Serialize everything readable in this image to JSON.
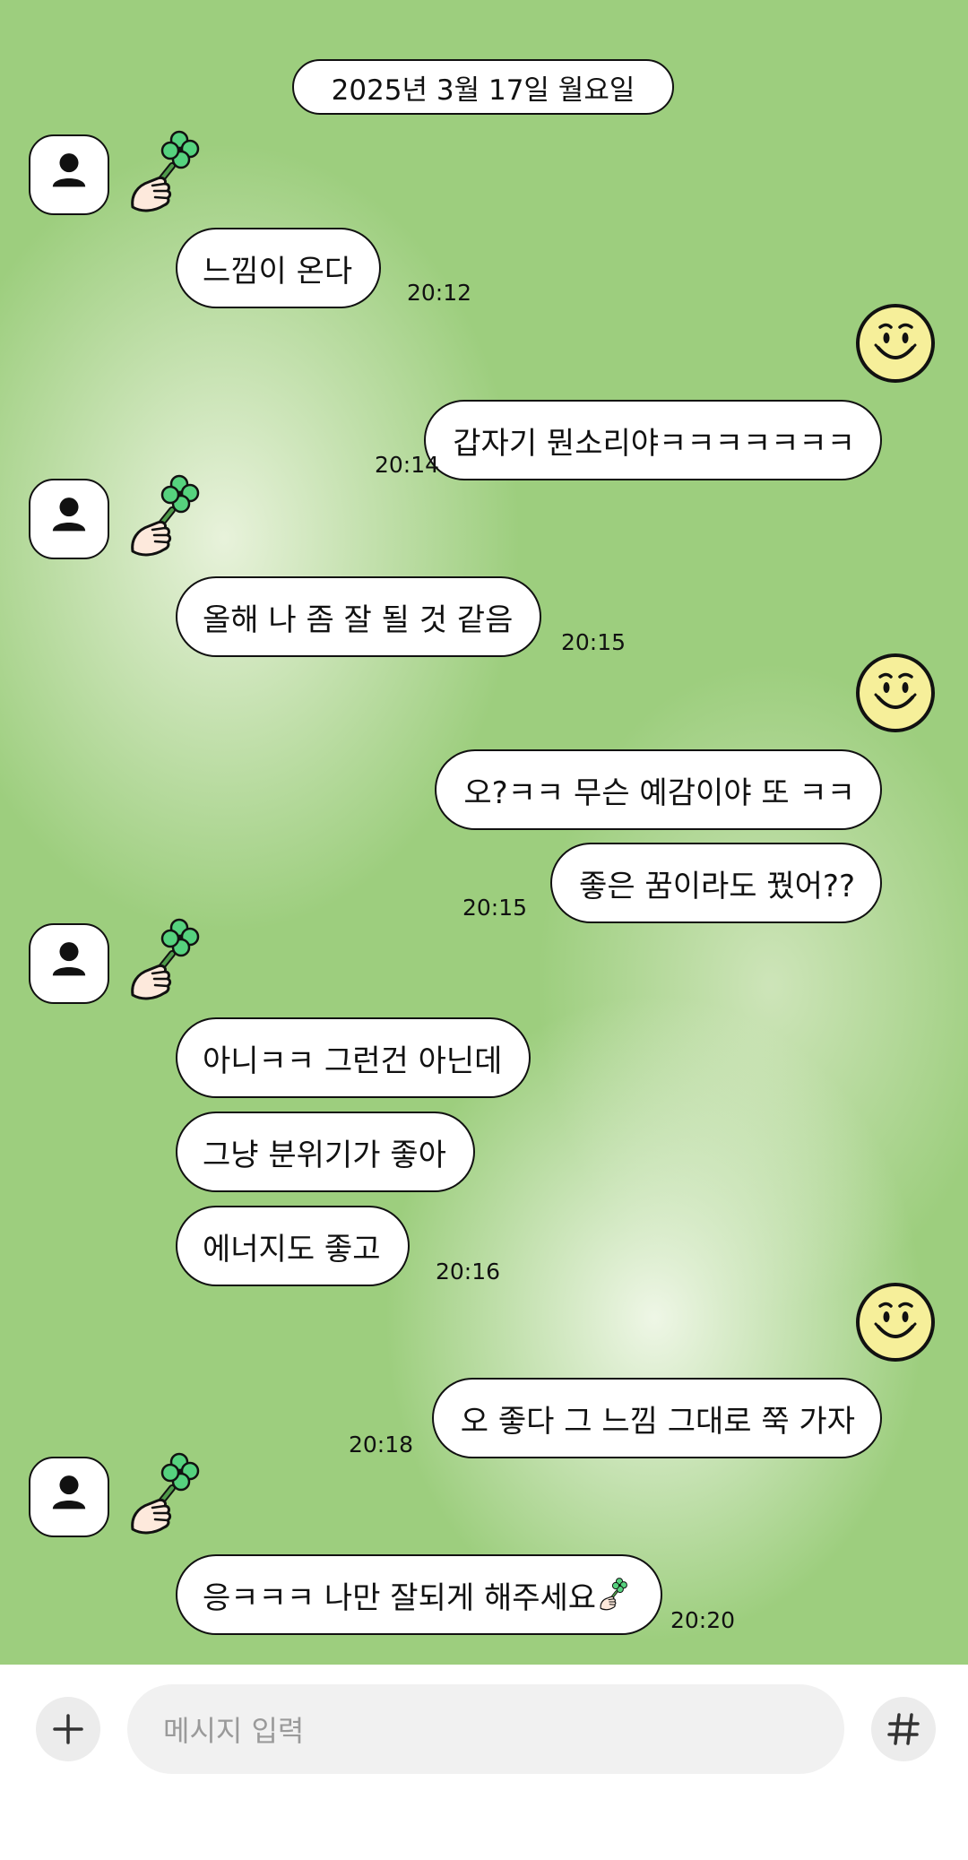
{
  "date_divider": "2025년 3월 17일 월요일",
  "messages": [
    {
      "text": "느낌이 온다",
      "time": "20:12"
    },
    {
      "text": "갑자기 뭔소리야ㅋㅋㅋㅋㅋㅋㅋ",
      "time": "20:14"
    },
    {
      "text": "올해 나 좀 잘 될 것 같음",
      "time": "20:15"
    },
    {
      "text": "오?ㅋㅋ 무슨 예감이야 또 ㅋㅋ",
      "time": ""
    },
    {
      "text": "좋은 꿈이라도 꿨어??",
      "time": "20:15"
    },
    {
      "text": "아니ㅋㅋ 그런건 아닌데",
      "time": ""
    },
    {
      "text": "그냥 분위기가 좋아",
      "time": ""
    },
    {
      "text": "에너지도 좋고",
      "time": "20:16"
    },
    {
      "text": "오 좋다 그 느낌 그대로 쭉 가자",
      "time": "20:18"
    },
    {
      "text": "응ㅋㅋㅋ 나만 잘되게 해주세요",
      "time": "20:20"
    }
  ],
  "input": {
    "placeholder": "메시지 입력"
  },
  "icons": {
    "attach": "plus-icon",
    "hashtag": "hash-icon",
    "avatar": "person-icon",
    "sticker": "clover-hand-icon",
    "emoji": "smiley-icon"
  },
  "colors": {
    "background": "#9dce7e",
    "bubble": "#ffffff",
    "outline": "#111111",
    "smiley": "#f6ef9a",
    "clover": "#55d07c"
  }
}
